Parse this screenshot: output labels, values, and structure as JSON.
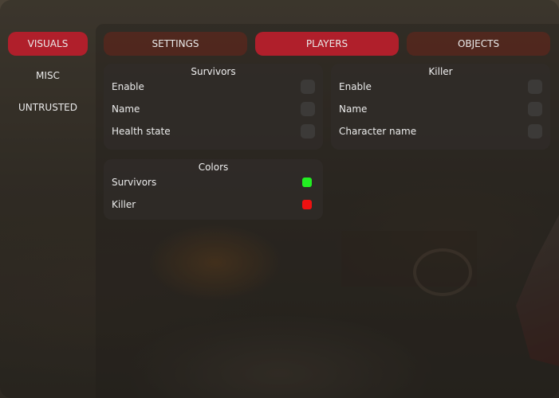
{
  "sidebar": {
    "items": [
      {
        "label": "VISUALS",
        "active": true
      },
      {
        "label": "MISC",
        "active": false
      },
      {
        "label": "UNTRUSTED",
        "active": false
      }
    ]
  },
  "tabs": [
    {
      "label": "SETTINGS",
      "active": false
    },
    {
      "label": "PLAYERS",
      "active": true
    },
    {
      "label": "OBJECTS",
      "active": false
    }
  ],
  "panels": {
    "survivors": {
      "title": "Survivors",
      "rows": [
        {
          "label": "Enable",
          "checked": false
        },
        {
          "label": "Name",
          "checked": false
        },
        {
          "label": "Health state",
          "checked": false
        }
      ]
    },
    "killer": {
      "title": "Killer",
      "rows": [
        {
          "label": "Enable",
          "checked": false
        },
        {
          "label": "Name",
          "checked": false
        },
        {
          "label": "Character name",
          "checked": false
        }
      ]
    },
    "colors": {
      "title": "Colors",
      "rows": [
        {
          "label": "Survivors",
          "color": "#22ee22"
        },
        {
          "label": "Killer",
          "color": "#ee1111"
        }
      ]
    }
  },
  "theme": {
    "accent": "#b01f2b"
  }
}
